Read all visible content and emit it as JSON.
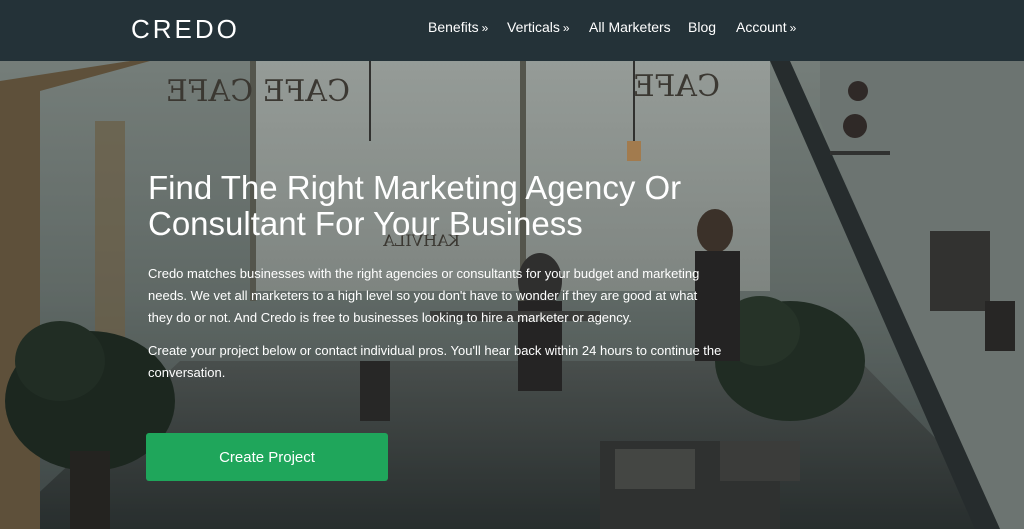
{
  "header": {
    "logo": "CREDO",
    "nav": [
      {
        "label": "Benefits",
        "arrow": "»"
      },
      {
        "label": "Verticals",
        "arrow": "»"
      },
      {
        "label": "All Marketers",
        "arrow": ""
      },
      {
        "label": "Blog",
        "arrow": ""
      },
      {
        "label": "Account",
        "arrow": "»"
      }
    ]
  },
  "hero": {
    "headline_line1": "Find The Right Marketing Agency Or",
    "headline_line2": "Consultant For Your Business",
    "paragraph1": "Credo matches businesses with the right agencies or consultants for your budget and marketing needs. We vet all marketers to a high level so you don't have to wonder if they are good at what they do or not. And Credo is free to businesses looking to hire a marketer or agency.",
    "paragraph2": "Create your project below or contact individual pros. You'll hear back within 24 hours to continue the conversation.",
    "cta_label": "Create Project",
    "sign_text_top": "CAFE CAFE",
    "sign_text_lower": "KAHVILA KAHVILA"
  },
  "colors": {
    "nav_bg": "#243238",
    "cta_green": "#1fa65b",
    "text": "#ffffff"
  }
}
